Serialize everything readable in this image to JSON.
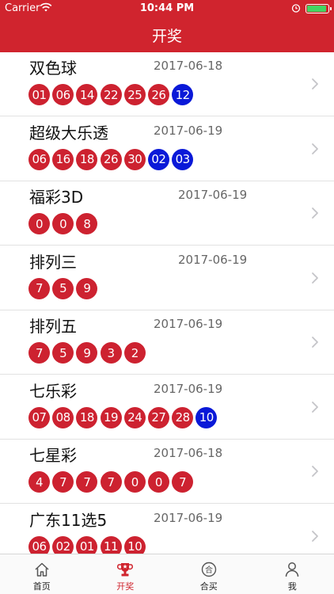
{
  "status": {
    "carrier": "Carrier",
    "time": "10:44 PM"
  },
  "nav": {
    "title": "开奖"
  },
  "lotteries": [
    {
      "name": "双色球",
      "date": "2017-06-18",
      "red": [
        "01",
        "06",
        "14",
        "22",
        "25",
        "26"
      ],
      "blue": [
        "12"
      ]
    },
    {
      "name": "超级大乐透",
      "date": "2017-06-19",
      "red": [
        "06",
        "16",
        "18",
        "26",
        "30"
      ],
      "blue": [
        "02",
        "03"
      ]
    },
    {
      "name": "福彩3D",
      "date": "2017-06-19",
      "red": [
        "0",
        "0",
        "8"
      ],
      "blue": []
    },
    {
      "name": "排列三",
      "date": "2017-06-19",
      "red": [
        "7",
        "5",
        "9"
      ],
      "blue": []
    },
    {
      "name": "排列五",
      "date": "2017-06-19",
      "red": [
        "7",
        "5",
        "9",
        "3",
        "2"
      ],
      "blue": []
    },
    {
      "name": "七乐彩",
      "date": "2017-06-19",
      "red": [
        "07",
        "08",
        "18",
        "19",
        "24",
        "27",
        "28"
      ],
      "blue": [
        "10"
      ]
    },
    {
      "name": "七星彩",
      "date": "2017-06-18",
      "red": [
        "4",
        "7",
        "7",
        "7",
        "0",
        "0",
        "7"
      ],
      "blue": []
    },
    {
      "name": "广东11选5",
      "date": "2017-06-19",
      "red": [
        "06",
        "02",
        "01",
        "11",
        "10"
      ],
      "blue": []
    }
  ],
  "tabs": [
    {
      "label": "首页",
      "icon": "home-icon"
    },
    {
      "label": "开奖",
      "icon": "trophy-icon",
      "active": true
    },
    {
      "label": "合买",
      "icon": "group-buy-icon"
    },
    {
      "label": "我",
      "icon": "person-icon"
    }
  ],
  "colors": {
    "brand": "#d0242e",
    "red_ball": "#cd2230",
    "blue_ball": "#0a19d8"
  }
}
